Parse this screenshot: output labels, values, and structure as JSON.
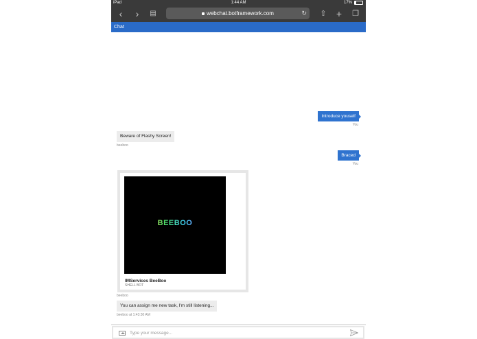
{
  "status_bar": {
    "device": "iPad",
    "time": "1:44 AM",
    "battery_text": "17%",
    "battery_level": 0.17
  },
  "browser": {
    "url": "webchat.botframework.com",
    "icons": [
      "back-icon",
      "forward-icon",
      "bookmarks-icon",
      "lock-icon",
      "reload-icon",
      "share-icon",
      "new-tab-icon",
      "tabs-icon"
    ]
  },
  "chat": {
    "header_title": "Chat",
    "messages": [
      {
        "from": "user",
        "text": "Introduce youself",
        "meta": "You"
      },
      {
        "from": "bot",
        "text": "Beware of Flashy Screen!",
        "meta": "beeboo"
      },
      {
        "from": "user",
        "text": "Braced",
        "meta": "You"
      },
      {
        "from": "bot",
        "type": "card",
        "card_logo": "BEEBOO",
        "card_title": "IMServices BeeBoo",
        "card_subtitle": "SHELL BOT",
        "meta": "beeboo"
      },
      {
        "from": "bot",
        "text": "You can assign me new task, I'm still listening...",
        "meta": "beeboo at 1:43:30 AM"
      }
    ],
    "input": {
      "placeholder": "Type your message...",
      "value": ""
    }
  },
  "colors": {
    "accent": "#2a6bc8",
    "user_bubble": "#2f73cf",
    "bot_bubble": "#ececec",
    "toolbar": "#3a3a3a"
  }
}
